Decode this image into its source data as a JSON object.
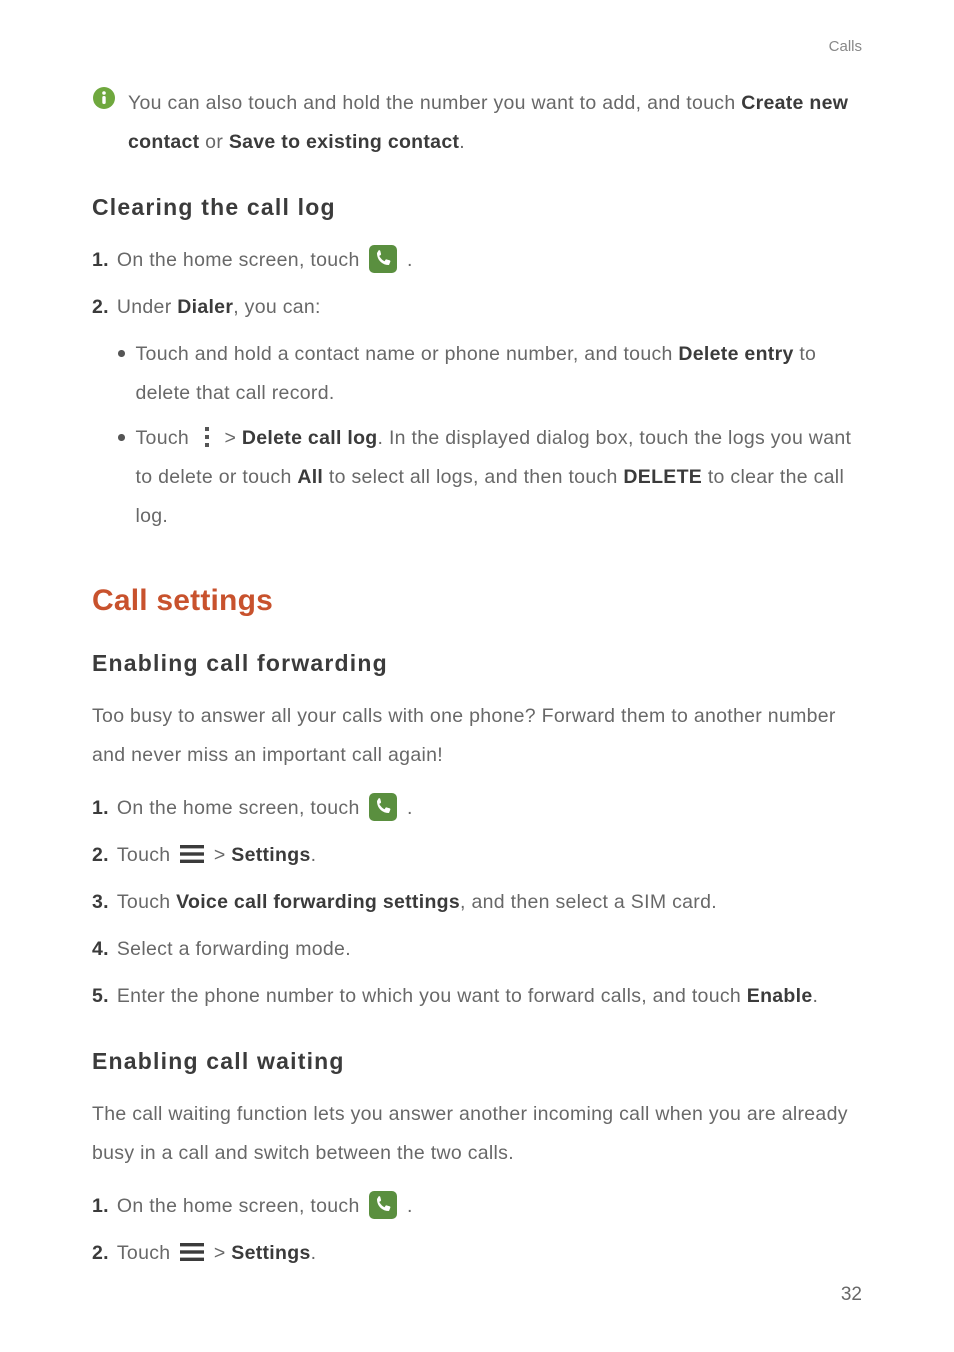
{
  "header": {
    "label": "Calls"
  },
  "info": {
    "line1_prefix": "You can also touch and hold the number you want to add, and touch ",
    "bold1": "Create new contact",
    "mid": " or ",
    "bold2": "Save to existing contact",
    "suffix": "."
  },
  "section_clearing": {
    "title": "Clearing  the  call  log",
    "step1_prefix": "On the home screen, touch ",
    "step1_suffix": " .",
    "step2_prefix": "Under ",
    "step2_bold": "Dialer",
    "step2_suffix": ", you can:",
    "bullet1_prefix": "Touch and hold a contact name or phone number, and touch ",
    "bullet1_bold": "Delete entry",
    "bullet1_suffix": " to delete that call record.",
    "bullet2_prefix": "Touch ",
    "bullet2_mid1": "  > ",
    "bullet2_bold1": "Delete call log",
    "bullet2_mid2": ". In the displayed dialog box, touch the logs you want to delete or touch ",
    "bullet2_bold2": "All",
    "bullet2_mid3": " to select all logs, and then touch ",
    "bullet2_bold3": "DELETE",
    "bullet2_suffix": " to clear the call log."
  },
  "chapter": {
    "title": "Call settings"
  },
  "section_forwarding": {
    "title": "Enabling  call  forwarding",
    "intro": "Too busy to answer all your calls with one phone? Forward them to another number and never miss an important call again!",
    "step1_prefix": "On the home screen, touch ",
    "step1_suffix": " .",
    "step2_prefix": "Touch ",
    "step2_mid": " > ",
    "step2_bold": "Settings",
    "step2_suffix": ".",
    "step3_prefix": "Touch ",
    "step3_bold": "Voice call forwarding settings",
    "step3_suffix": ", and then select a SIM card.",
    "step4": "Select a forwarding mode.",
    "step5_prefix": "Enter the phone number to which you want to forward calls, and touch ",
    "step5_bold": "Enable",
    "step5_suffix": "."
  },
  "section_waiting": {
    "title": "Enabling  call  waiting",
    "intro": "The call waiting function lets you answer another incoming call when you are already busy in a call and switch between the two calls.",
    "step1_prefix": "On the home screen, touch ",
    "step1_suffix": " .",
    "step2_prefix": "Touch ",
    "step2_mid": " > ",
    "step2_bold": "Settings",
    "step2_suffix": "."
  },
  "labels": {
    "n1": "1.",
    "n2": "2.",
    "n3": "3.",
    "n4": "4.",
    "n5": "5."
  },
  "page": "32"
}
